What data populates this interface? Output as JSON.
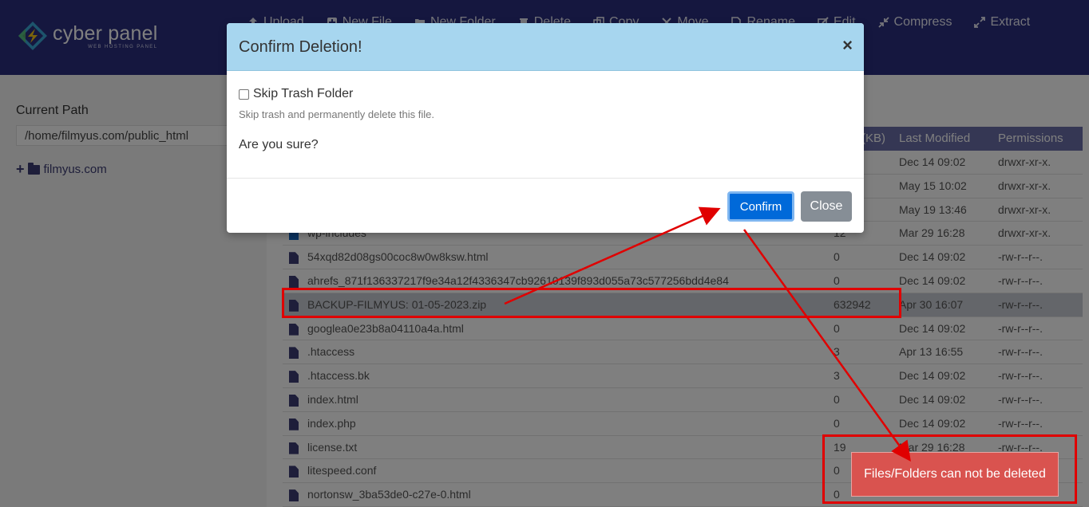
{
  "header": {
    "logo_title": "cyber panel",
    "logo_subtitle": "WEB HOSTING PANEL",
    "toolbar": [
      {
        "label": "Upload",
        "icon": "upload-icon"
      },
      {
        "label": "New File",
        "icon": "new-file-icon"
      },
      {
        "label": "New Folder",
        "icon": "new-folder-icon"
      },
      {
        "label": "Delete",
        "icon": "trash-icon"
      },
      {
        "label": "Copy",
        "icon": "copy-icon"
      },
      {
        "label": "Move",
        "icon": "move-icon"
      },
      {
        "label": "Rename",
        "icon": "rename-icon"
      },
      {
        "label": "Edit",
        "icon": "edit-icon"
      },
      {
        "label": "Compress",
        "icon": "compress-icon"
      },
      {
        "label": "Extract",
        "icon": "extract-icon"
      }
    ]
  },
  "sidebar": {
    "current_path_label": "Current Path",
    "current_path_value": "/home/filmyus.com/public_html",
    "tree_root": "filmyus.com"
  },
  "table": {
    "columns": {
      "size": "(KB)",
      "modified": "Last Modified",
      "permissions": "Permissions"
    },
    "rows": [
      {
        "type": "dir",
        "name": "",
        "size": "",
        "modified": "Dec 14 09:02",
        "perm": "drwxr-xr-x."
      },
      {
        "type": "dir",
        "name": "",
        "size": "",
        "modified": "May 15 10:02",
        "perm": "drwxr-xr-x."
      },
      {
        "type": "dir",
        "name": "",
        "size": "",
        "modified": "May 19 13:46",
        "perm": "drwxr-xr-x."
      },
      {
        "type": "dir",
        "name": "wp-includes",
        "size": "12",
        "modified": "Mar 29 16:28",
        "perm": "drwxr-xr-x."
      },
      {
        "type": "file",
        "name": "54xqd82d08gs00coc8w0w8ksw.html",
        "size": "0",
        "modified": "Dec 14 09:02",
        "perm": "-rw-r--r--."
      },
      {
        "type": "file",
        "name": "ahrefs_871f136337217f9e34a12f4336347cb92610139f893d055a73c577256bdd4e84",
        "size": "0",
        "modified": "Dec 14 09:02",
        "perm": "-rw-r--r--."
      },
      {
        "type": "file",
        "name": "BACKUP-FILMYUS: 01-05-2023.zip",
        "size": "632942",
        "modified": "Apr 30 16:07",
        "perm": "-rw-r--r--.",
        "selected": true
      },
      {
        "type": "file",
        "name": "googlea0e23b8a04110a4a.html",
        "size": "0",
        "modified": "Dec 14 09:02",
        "perm": "-rw-r--r--."
      },
      {
        "type": "file",
        "name": ".htaccess",
        "size": "3",
        "modified": "Apr 13 16:55",
        "perm": "-rw-r--r--."
      },
      {
        "type": "file",
        "name": ".htaccess.bk",
        "size": "3",
        "modified": "Dec 14 09:02",
        "perm": "-rw-r--r--."
      },
      {
        "type": "file",
        "name": "index.html",
        "size": "0",
        "modified": "Dec 14 09:02",
        "perm": "-rw-r--r--."
      },
      {
        "type": "file",
        "name": "index.php",
        "size": "0",
        "modified": "Dec 14 09:02",
        "perm": "-rw-r--r--."
      },
      {
        "type": "file",
        "name": "license.txt",
        "size": "19",
        "modified": "Mar 29 16:28",
        "perm": "-rw-r--r--."
      },
      {
        "type": "file",
        "name": "litespeed.conf",
        "size": "0",
        "modified": "",
        "perm": ""
      },
      {
        "type": "file",
        "name": "nortonsw_3ba53de0-c27e-0.html",
        "size": "0",
        "modified": "",
        "perm": ""
      }
    ]
  },
  "modal": {
    "title": "Confirm Deletion!",
    "close_glyph": "×",
    "skip_trash_label": "Skip Trash Folder",
    "skip_trash_help": "Skip trash and permanently delete this file.",
    "question": "Are you sure?",
    "confirm_label": "Confirm",
    "close_label": "Close"
  },
  "toast": {
    "message": "Files/Folders can not be deleted"
  },
  "colors": {
    "header_bg": "#2a2f7e",
    "modal_header_bg": "#a7d6ef",
    "confirm_bg": "#0069d9",
    "close_bg": "#868e96",
    "toast_bg": "#d9534f",
    "annotation": "#e00000"
  }
}
